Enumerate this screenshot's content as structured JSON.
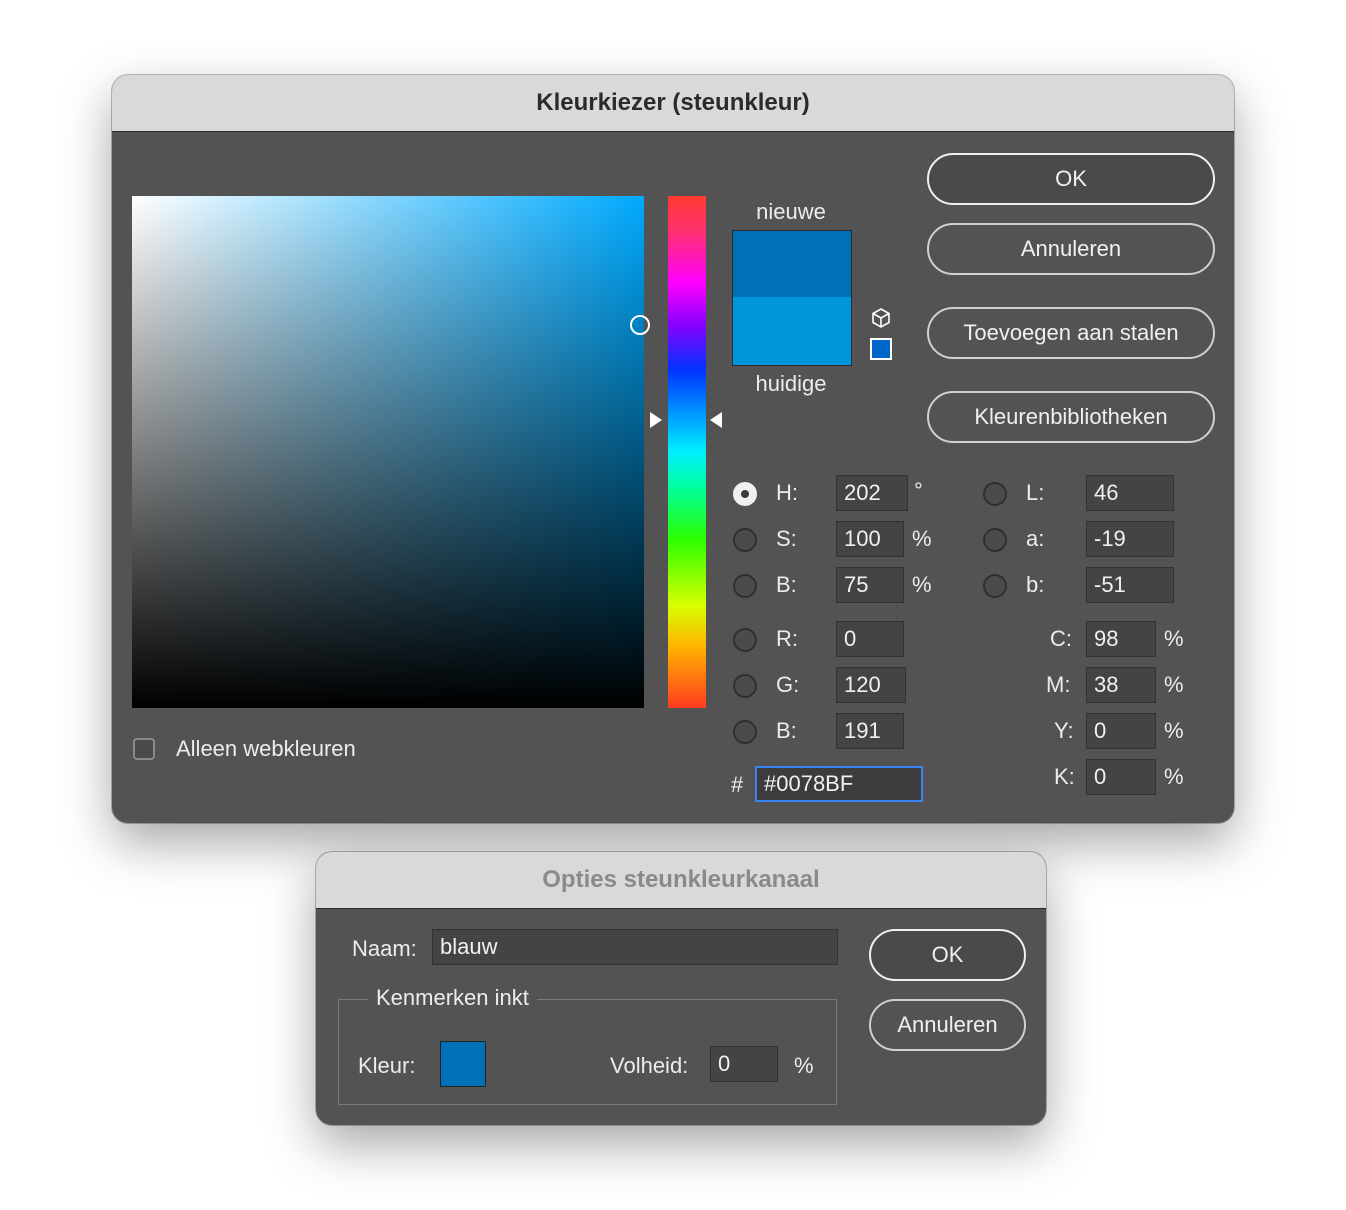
{
  "picker": {
    "title": "Kleurkiezer (steunkleur)",
    "new_label": "nieuwe",
    "current_label": "huidige",
    "buttons": {
      "ok": "OK",
      "cancel": "Annuleren",
      "add_to_swatches": "Toevoegen aan stalen",
      "color_libraries": "Kleurenbibliotheken"
    },
    "web_only_label": "Alleen webkleuren",
    "web_only_checked": false,
    "hsb": {
      "h_label": "H:",
      "h_value": "202",
      "h_unit": "°",
      "s_label": "S:",
      "s_value": "100",
      "s_unit": "%",
      "b_label": "B:",
      "b_value": "75",
      "b_unit": "%"
    },
    "rgb": {
      "r_label": "R:",
      "r_value": "0",
      "g_label": "G:",
      "g_value": "120",
      "b_label": "B:",
      "b_value": "191"
    },
    "lab": {
      "l_label": "L:",
      "l_value": "46",
      "a_label": "a:",
      "a_value": "-19",
      "b_label": "b:",
      "b_value": "-51"
    },
    "cmyk": {
      "c_label": "C:",
      "c_value": "98",
      "c_unit": "%",
      "m_label": "M:",
      "m_value": "38",
      "m_unit": "%",
      "y_label": "Y:",
      "y_value": "0",
      "y_unit": "%",
      "k_label": "K:",
      "k_value": "0",
      "k_unit": "%"
    },
    "hex_label": "#",
    "hex_value": "#0078BF",
    "selected_mode": "H",
    "new_color": "#0070B8",
    "current_color": "#0096DB"
  },
  "spot": {
    "title": "Opties steunkleurkanaal",
    "name_label": "Naam:",
    "name_value": "blauw",
    "group_label": "Kenmerken inkt",
    "color_label": "Kleur:",
    "solidity_label": "Volheid:",
    "solidity_value": "0",
    "solidity_unit": "%",
    "ink_color": "#0070B8",
    "buttons": {
      "ok": "OK",
      "cancel": "Annuleren"
    }
  }
}
